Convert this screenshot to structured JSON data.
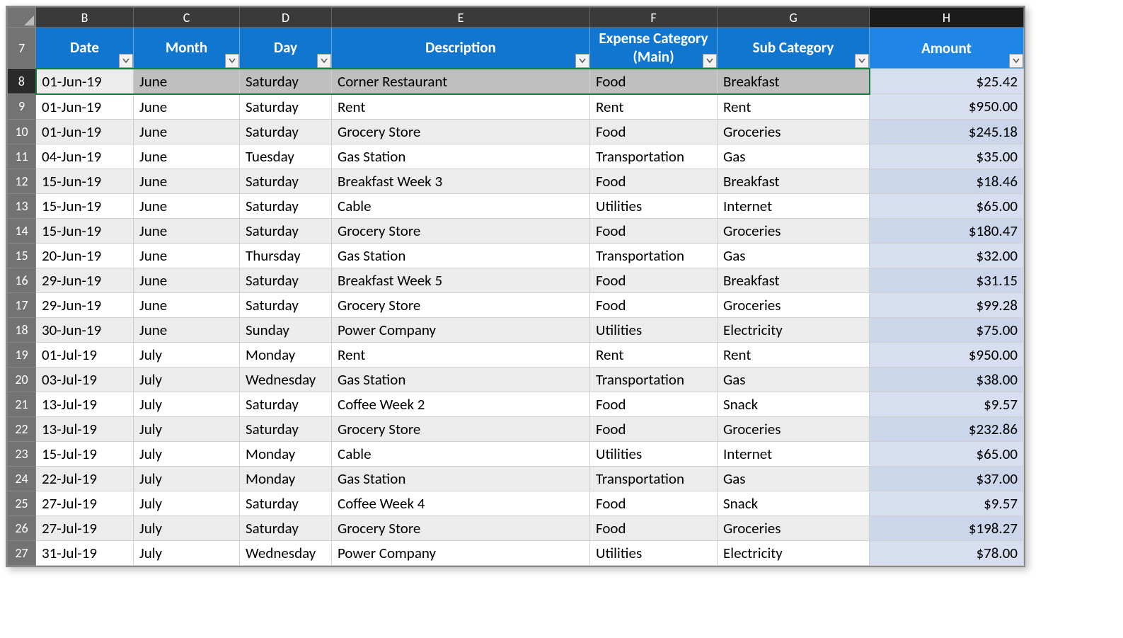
{
  "columns": [
    "B",
    "C",
    "D",
    "E",
    "F",
    "G",
    "H"
  ],
  "headerRowNum": "7",
  "headers": {
    "B": "Date",
    "C": "Month",
    "D": "Day",
    "E": "Description",
    "F": "Expense Category (Main)",
    "G": "Sub Category",
    "H": "Amount"
  },
  "rows": [
    {
      "n": "8",
      "date": "01-Jun-19",
      "month": "June",
      "day": "Saturday",
      "desc": "Corner Restaurant",
      "cat": "Food",
      "sub": "Breakfast",
      "amt": "$25.42",
      "even": true,
      "sel": true
    },
    {
      "n": "9",
      "date": "01-Jun-19",
      "month": "June",
      "day": "Saturday",
      "desc": "Rent",
      "cat": "Rent",
      "sub": "Rent",
      "amt": "$950.00",
      "even": false
    },
    {
      "n": "10",
      "date": "01-Jun-19",
      "month": "June",
      "day": "Saturday",
      "desc": "Grocery Store",
      "cat": "Food",
      "sub": "Groceries",
      "amt": "$245.18",
      "even": true
    },
    {
      "n": "11",
      "date": "04-Jun-19",
      "month": "June",
      "day": "Tuesday",
      "desc": "Gas Station",
      "cat": "Transportation",
      "sub": "Gas",
      "amt": "$35.00",
      "even": false
    },
    {
      "n": "12",
      "date": "15-Jun-19",
      "month": "June",
      "day": "Saturday",
      "desc": "Breakfast Week 3",
      "cat": "Food",
      "sub": "Breakfast",
      "amt": "$18.46",
      "even": true
    },
    {
      "n": "13",
      "date": "15-Jun-19",
      "month": "June",
      "day": "Saturday",
      "desc": "Cable",
      "cat": "Utilities",
      "sub": "Internet",
      "amt": "$65.00",
      "even": false
    },
    {
      "n": "14",
      "date": "15-Jun-19",
      "month": "June",
      "day": "Saturday",
      "desc": "Grocery Store",
      "cat": "Food",
      "sub": "Groceries",
      "amt": "$180.47",
      "even": true
    },
    {
      "n": "15",
      "date": "20-Jun-19",
      "month": "June",
      "day": "Thursday",
      "desc": "Gas Station",
      "cat": "Transportation",
      "sub": "Gas",
      "amt": "$32.00",
      "even": false
    },
    {
      "n": "16",
      "date": "29-Jun-19",
      "month": "June",
      "day": "Saturday",
      "desc": "Breakfast Week 5",
      "cat": "Food",
      "sub": "Breakfast",
      "amt": "$31.15",
      "even": true
    },
    {
      "n": "17",
      "date": "29-Jun-19",
      "month": "June",
      "day": "Saturday",
      "desc": "Grocery Store",
      "cat": "Food",
      "sub": "Groceries",
      "amt": "$99.28",
      "even": false
    },
    {
      "n": "18",
      "date": "30-Jun-19",
      "month": "June",
      "day": "Sunday",
      "desc": "Power Company",
      "cat": "Utilities",
      "sub": "Electricity",
      "amt": "$75.00",
      "even": true
    },
    {
      "n": "19",
      "date": "01-Jul-19",
      "month": "July",
      "day": "Monday",
      "desc": "Rent",
      "cat": "Rent",
      "sub": "Rent",
      "amt": "$950.00",
      "even": false
    },
    {
      "n": "20",
      "date": "03-Jul-19",
      "month": "July",
      "day": "Wednesday",
      "desc": "Gas Station",
      "cat": "Transportation",
      "sub": "Gas",
      "amt": "$38.00",
      "even": true
    },
    {
      "n": "21",
      "date": "13-Jul-19",
      "month": "July",
      "day": "Saturday",
      "desc": "Coffee Week 2",
      "cat": "Food",
      "sub": "Snack",
      "amt": "$9.57",
      "even": false
    },
    {
      "n": "22",
      "date": "13-Jul-19",
      "month": "July",
      "day": "Saturday",
      "desc": "Grocery Store",
      "cat": "Food",
      "sub": "Groceries",
      "amt": "$232.86",
      "even": true
    },
    {
      "n": "23",
      "date": "15-Jul-19",
      "month": "July",
      "day": "Monday",
      "desc": "Cable",
      "cat": "Utilities",
      "sub": "Internet",
      "amt": "$65.00",
      "even": false
    },
    {
      "n": "24",
      "date": "22-Jul-19",
      "month": "July",
      "day": "Monday",
      "desc": "Gas Station",
      "cat": "Transportation",
      "sub": "Gas",
      "amt": "$37.00",
      "even": true
    },
    {
      "n": "25",
      "date": "27-Jul-19",
      "month": "July",
      "day": "Saturday",
      "desc": "Coffee Week 4",
      "cat": "Food",
      "sub": "Snack",
      "amt": "$9.57",
      "even": false
    },
    {
      "n": "26",
      "date": "27-Jul-19",
      "month": "July",
      "day": "Saturday",
      "desc": "Grocery Store",
      "cat": "Food",
      "sub": "Groceries",
      "amt": "$198.27",
      "even": true
    },
    {
      "n": "27",
      "date": "31-Jul-19",
      "month": "July",
      "day": "Wednesday",
      "desc": "Power Company",
      "cat": "Utilities",
      "sub": "Electricity",
      "amt": "$78.00",
      "even": false
    }
  ]
}
